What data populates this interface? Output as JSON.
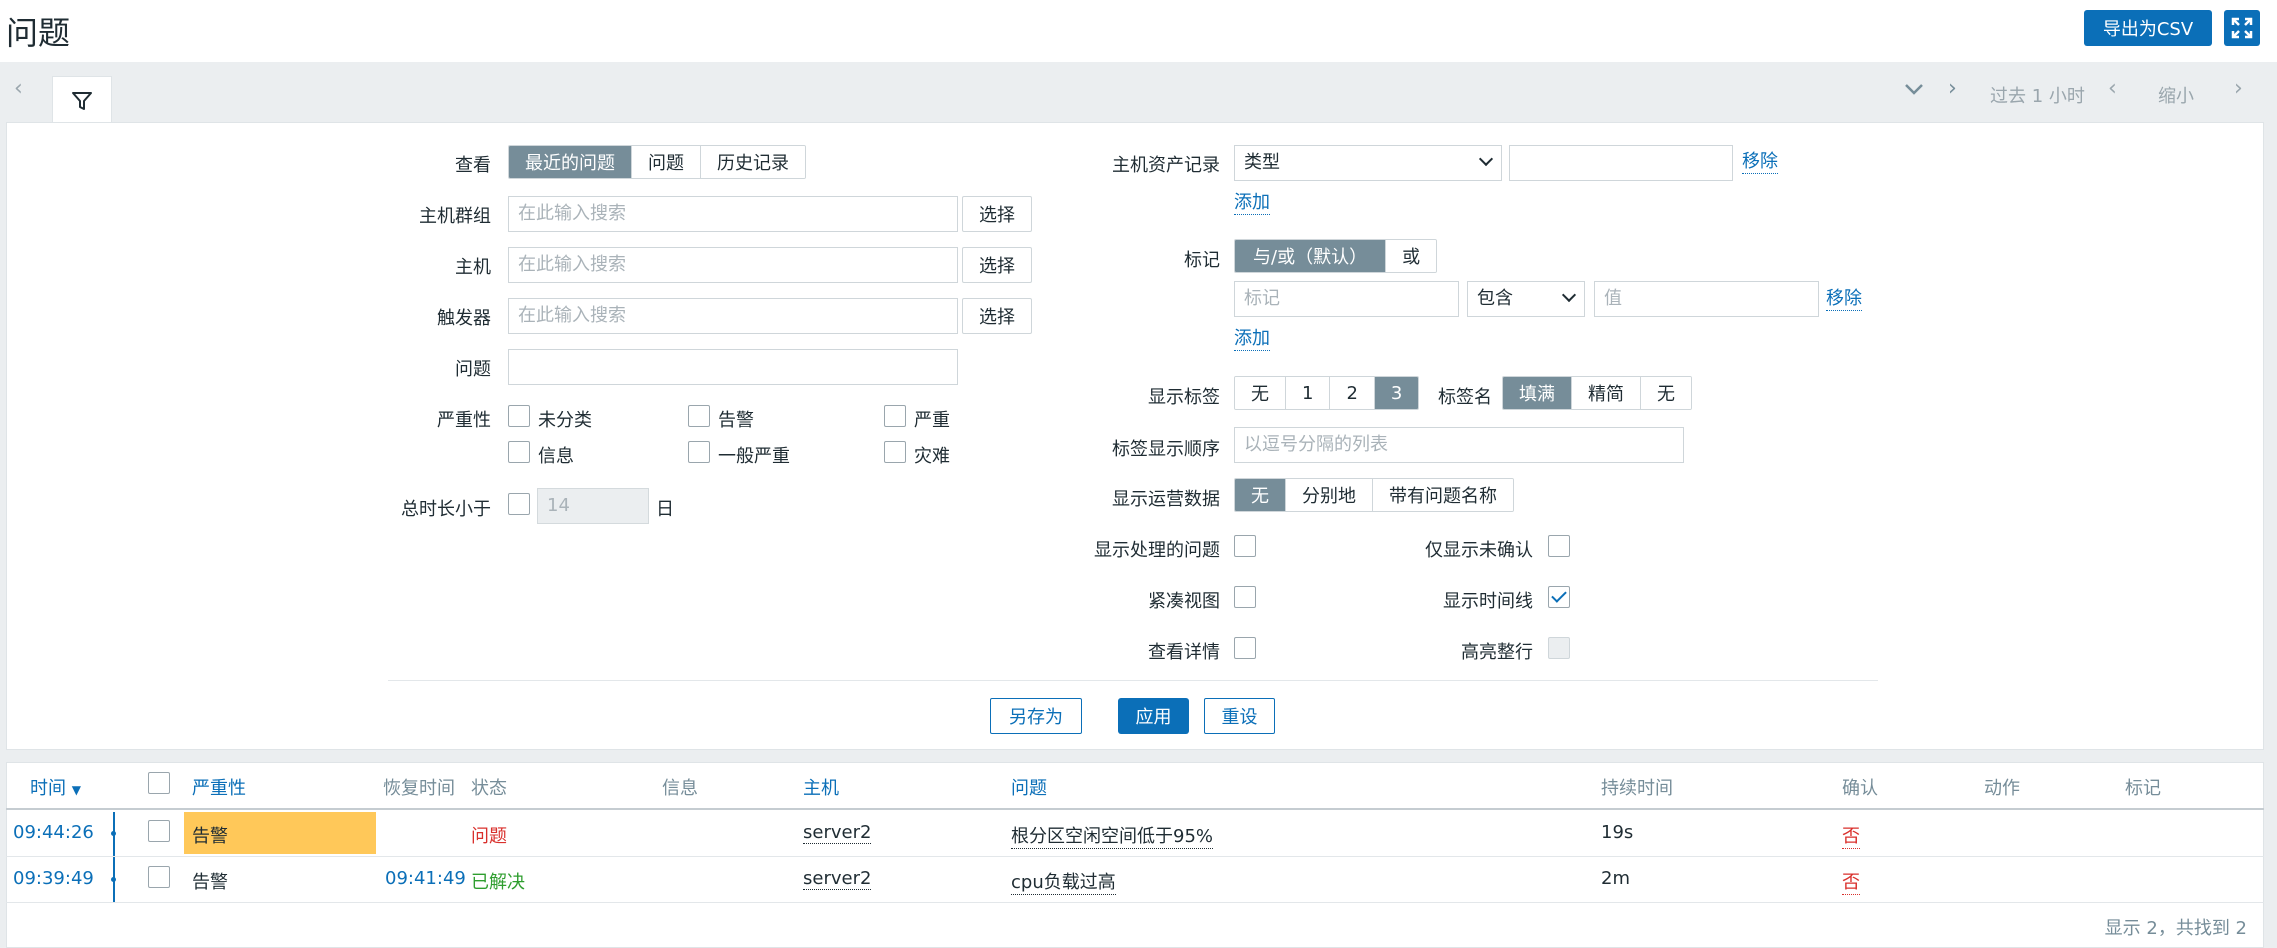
{
  "header": {
    "title": "问题",
    "export_label": "导出为CSV"
  },
  "timenav": {
    "period": "过去 1 小时",
    "zoom_out": "缩小"
  },
  "filter": {
    "view_label": "查看",
    "view_options": [
      "最近的问题",
      "问题",
      "历史记录"
    ],
    "view_active": 0,
    "hostgroups_label": "主机群组",
    "hosts_label": "主机",
    "triggers_label": "触发器",
    "search_placeholder": "在此输入搜索",
    "select_label": "选择",
    "problem_label": "问题",
    "problem_value": "",
    "severity_label": "严重性",
    "severities": [
      "未分类",
      "告警",
      "严重",
      "信息",
      "一般严重",
      "灾难"
    ],
    "age_label": "总时长小于",
    "age_value": "14",
    "age_unit": "日",
    "inventory_label": "主机资产记录",
    "inventory_type": "类型",
    "inventory_value": "",
    "remove_label": "移除",
    "add_label": "添加",
    "tags_label": "标记",
    "tags_eval_options": [
      "与/或（默认）",
      "或"
    ],
    "tag_placeholder": "标记",
    "tag_operator": "包含",
    "tag_value_placeholder": "值",
    "show_tags_label": "显示标签",
    "show_tags_options": [
      "无",
      "1",
      "2",
      "3"
    ],
    "tag_name_label": "标签名",
    "tag_name_options": [
      "填满",
      "精简",
      "无"
    ],
    "tag_priority_label": "标签显示顺序",
    "tag_priority_placeholder": "以逗号分隔的列表",
    "opdata_label": "显示运营数据",
    "opdata_options": [
      "无",
      "分别地",
      "带有问题名称"
    ],
    "show_suppressed_label": "显示处理的问题",
    "unack_label": "仅显示未确认",
    "compact_label": "紧凑视图",
    "timeline_label": "显示时间线",
    "details_label": "查看详情",
    "highlight_label": "高亮整行",
    "save_as_label": "另存为",
    "apply_label": "应用",
    "reset_label": "重设"
  },
  "table": {
    "columns": {
      "time": "时间",
      "severity": "严重性",
      "recovery": "恢复时间",
      "status": "状态",
      "info": "信息",
      "host": "主机",
      "problem": "问题",
      "duration": "持续时间",
      "ack": "确认",
      "actions": "动作",
      "tags": "标记"
    },
    "rows": [
      {
        "time": "09:44:26",
        "severity": "告警",
        "recovery": "",
        "status": "问题",
        "host": "server2",
        "problem": "根分区空闲空间低于95%",
        "duration": "19s",
        "ack": "否"
      },
      {
        "time": "09:39:49",
        "severity": "告警",
        "recovery": "09:41:49",
        "status": "已解决",
        "host": "server2",
        "problem": "cpu负载过高",
        "duration": "2m",
        "ack": "否"
      }
    ],
    "footer": "显示 2，共找到 2"
  },
  "colors": {
    "accent": "#0b6fb8",
    "warning": "#ffc859",
    "problem_status": "#d9302c",
    "resolved_status": "#2f9e2f"
  }
}
